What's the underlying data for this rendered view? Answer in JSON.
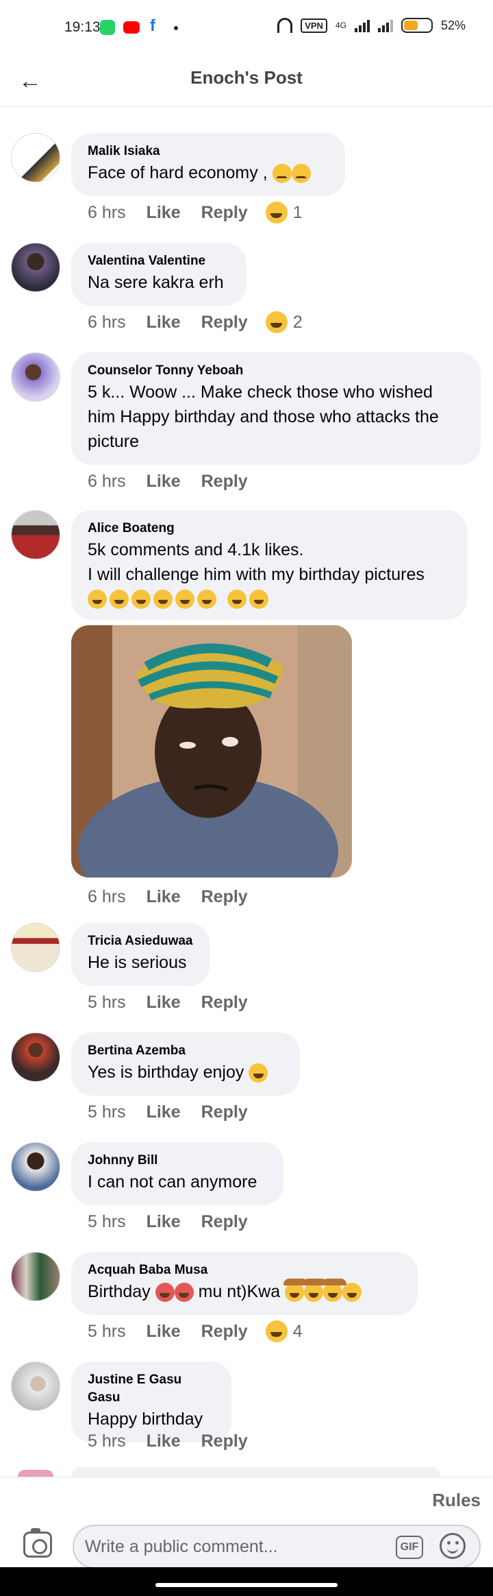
{
  "status_bar": {
    "time": "19:13",
    "vpn": "VPN",
    "network": "4G",
    "battery": "52%",
    "battery_level": 0.52,
    "app_icons": [
      "whatsapp-icon",
      "youtube-icon",
      "facebook-icon"
    ]
  },
  "header": {
    "title": "Enoch's Post",
    "back_icon": "back-arrow-icon"
  },
  "actions": {
    "like": "Like",
    "reply": "Reply"
  },
  "comments": [
    {
      "author": "Malik Isiaka",
      "lines": [
        "Face of hard economy ,"
      ],
      "time": "6 hrs",
      "reaction_count": "1"
    },
    {
      "author": "Valentina Valentine",
      "lines": [
        "Na sere kakra erh"
      ],
      "time": "6 hrs",
      "reaction_count": "2"
    },
    {
      "author": "Counselor Tonny Yeboah",
      "lines": [
        "5 k... Woow ... Make check those who wished",
        "him Happy birthday and those who attacks the",
        "picture"
      ],
      "time": "6 hrs",
      "reaction_count": ""
    },
    {
      "author": "Alice Boateng",
      "lines": [
        "5k comments and 4.1k likes.",
        "I will challenge him with my birthday pictures"
      ],
      "time": "6 hrs",
      "reaction_count": "",
      "has_photo": true
    },
    {
      "author": "Tricia Asieduwaa",
      "lines": [
        "He is serious"
      ],
      "time": "5 hrs",
      "reaction_count": ""
    },
    {
      "author": "Bertina Azemba",
      "lines": [
        "Yes is birthday enjoy"
      ],
      "time": "5 hrs",
      "reaction_count": ""
    },
    {
      "author": "Johnny Bill",
      "lines": [
        "I can not can anymore"
      ],
      "time": "5 hrs",
      "reaction_count": ""
    },
    {
      "author": "Acquah Baba Musa",
      "lines": [
        "Birthday",
        "mu nt)Kwa"
      ],
      "time": "5 hrs",
      "reaction_count": "4"
    },
    {
      "author": "Justine E Gasu Gasu",
      "lines": [
        "Happy birthday"
      ],
      "time": "5 hrs",
      "reaction_count": ""
    }
  ],
  "composer": {
    "rules": "Rules",
    "placeholder": "Write a public comment...",
    "gif": "GIF"
  },
  "colors": {
    "bubble": "#f0f2f5",
    "meta_text": "#65676b",
    "emoji": "#f7c33a"
  }
}
